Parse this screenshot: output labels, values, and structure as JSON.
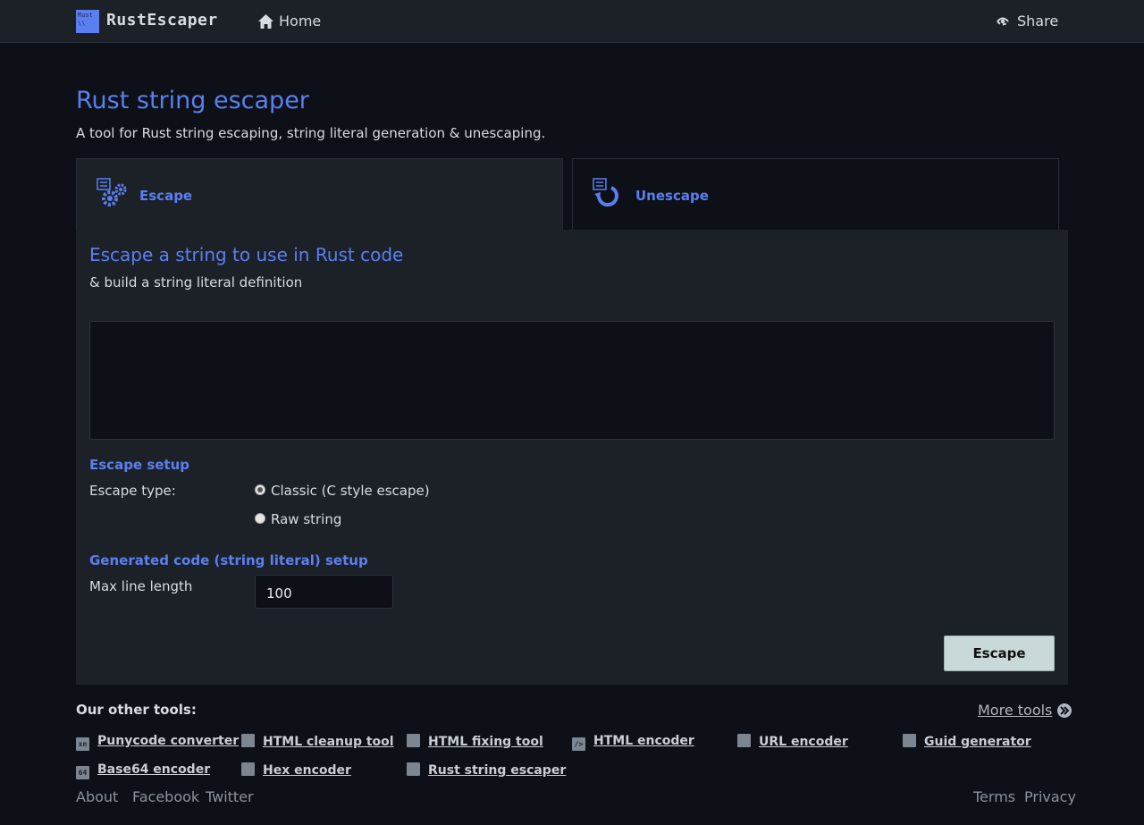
{
  "header": {
    "logo_text": "RustEscaper",
    "logo_icon_line1": "Rust",
    "logo_icon_line2": "\\\\",
    "home_label": "Home",
    "share_label": "Share"
  },
  "page": {
    "title": "Rust string escaper",
    "subtitle": "A tool for Rust string escaping, string literal generation & unescaping."
  },
  "tabs": [
    {
      "label": "Escape"
    },
    {
      "label": "Unescape"
    }
  ],
  "panel": {
    "title": "Escape a string to use in Rust code",
    "subtitle": "& build a string literal definition",
    "input_value": "",
    "escape_setup_label": "Escape setup",
    "escape_type_label": "Escape type:",
    "option_classic": "Classic (C style escape)",
    "option_raw": "Raw string",
    "generated_setup_label": "Generated code (string literal) setup",
    "max_line_label": "Max line length",
    "max_line_value": "100",
    "escape_button": "Escape"
  },
  "other_tools": {
    "title": "Our other tools:",
    "more_label": "More tools",
    "items": [
      {
        "label": "Punycode converter",
        "icon": "xn"
      },
      {
        "label": "HTML cleanup tool",
        "icon": ""
      },
      {
        "label": "HTML fixing tool",
        "icon": ""
      },
      {
        "label": "HTML encoder",
        "icon": "/>"
      },
      {
        "label": "URL encoder",
        "icon": ""
      },
      {
        "label": "Guid generator",
        "icon": ""
      },
      {
        "label": "Base64 encoder",
        "icon": "64"
      },
      {
        "label": "Hex encoder",
        "icon": ""
      },
      {
        "label": "Rust string escaper",
        "icon": ""
      }
    ]
  },
  "footer": {
    "about": "About",
    "facebook": "Facebook",
    "twitter": "Twitter",
    "terms": "Terms",
    "privacy": "Privacy"
  },
  "colors": {
    "accent": "#5b7ff0",
    "background": "#0d1117",
    "panel": "#1c2128"
  }
}
